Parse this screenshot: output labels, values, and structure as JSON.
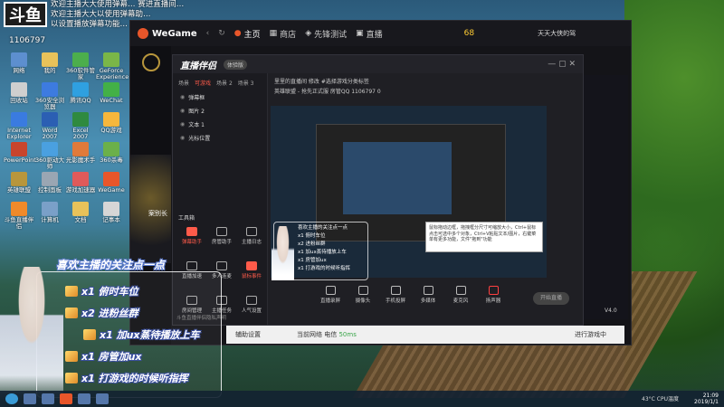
{
  "stream": {
    "logo_text": "斗鱼",
    "ticker": [
      "欢迎主播大大使用弹幕… 赛进直播间…",
      "欢迎主播大大以使用弹幕助…",
      "以设置播放弹幕功能…"
    ],
    "room_id": "1106797",
    "chat_title": "喜欢主播的关注点一点",
    "gifts": [
      {
        "text": "x1 俯时车位"
      },
      {
        "text": "x2 进粉丝群"
      },
      {
        "text": "x1 加ux蒸待播放上车"
      },
      {
        "text": "x1 房管加ux"
      },
      {
        "text": "x1 打游戏的时候听指挥"
      }
    ],
    "small_chat": [
      "喜欢主播的关注点一点",
      "x1 俯时车位",
      "x2 进粉丝群",
      "x1 加ux蒸待播放上车",
      "x1 房管加ux",
      "x1 打游戏的时候听指挥"
    ]
  },
  "desktop": {
    "icons": [
      "网络",
      "我的",
      "360软件管家",
      "GeForce Experience",
      "回收站",
      "360安全浏览器",
      "腾讯QQ",
      "WeChat",
      "Internet Explorer",
      "Word 2007",
      "Excel 2007",
      "QQ游戏",
      "PowerPoint",
      "360驱动大师",
      "光影魔术手",
      "360杀毒",
      "英雄联盟",
      "控制面板",
      "游戏加速器",
      "WeGame",
      "斗鱼直播伴侣",
      "计算机",
      "文档",
      "记事本"
    ]
  },
  "wegame": {
    "brand": "WeGame",
    "tabs": [
      {
        "label": "主页",
        "active": true
      },
      {
        "label": "商店",
        "active": false
      },
      {
        "label": "先锋测试",
        "active": false
      },
      {
        "label": "直播",
        "active": false
      }
    ],
    "level": "68",
    "user": "天天大侠的驾",
    "bottom": "辅助设置",
    "bottom_status": "当前网络 电信",
    "bottom_ms": "50ms",
    "launch": "进行游戏中",
    "side_text": "案别长",
    "version": "V4.0"
  },
  "zhibo": {
    "title": "直播伴侣",
    "badge": "体验版",
    "scene_tabs": [
      "场景",
      "可游戏",
      "场景 2",
      "场景 3"
    ],
    "sources": [
      "弹幕框",
      "图片 2",
      "文本 1",
      "光标位置"
    ],
    "tools_title": "工具箱",
    "tools": [
      {
        "label": "弹幕助手",
        "red": true
      },
      {
        "label": "房管助手",
        "red": false
      },
      {
        "label": "主播日志",
        "red": false
      },
      {
        "label": "直播加速",
        "red": false
      },
      {
        "label": "多人连麦",
        "red": false
      },
      {
        "label": "鼠标事件",
        "red": true
      },
      {
        "label": "房间管理",
        "red": false
      },
      {
        "label": "主播任务",
        "red": false
      },
      {
        "label": "人气设置",
        "red": false
      }
    ],
    "info_line1": "里里的直播间 修改 #选择游戏分类标签",
    "info_line2": "英雄联盟 - 抢先正式服 房管QQ 1106797 0",
    "controls": [
      {
        "label": "直播录屏",
        "red": false
      },
      {
        "label": "摄像头",
        "red": false
      },
      {
        "label": "手机投屏",
        "red": false
      },
      {
        "label": "多媒体",
        "red": false
      },
      {
        "label": "麦克风",
        "red": false
      },
      {
        "label": "扬声器",
        "red": true
      }
    ],
    "start_label": "开始直播",
    "footer": "斗鱼直播伴侣隐私声明",
    "tooltip": "鼠标拖动边框，拖拽框分尺寸可缩放大小，Ctrl+鼠标点击可选中多个对象，Ctrl+V粘贴文本/图片，右键菜单有更多功能，文件\"拖到\"功能"
  },
  "taskbar": {
    "temp": "43°C",
    "cpu": "CPU温度",
    "time": "21:09",
    "date": "2019/1/1"
  }
}
